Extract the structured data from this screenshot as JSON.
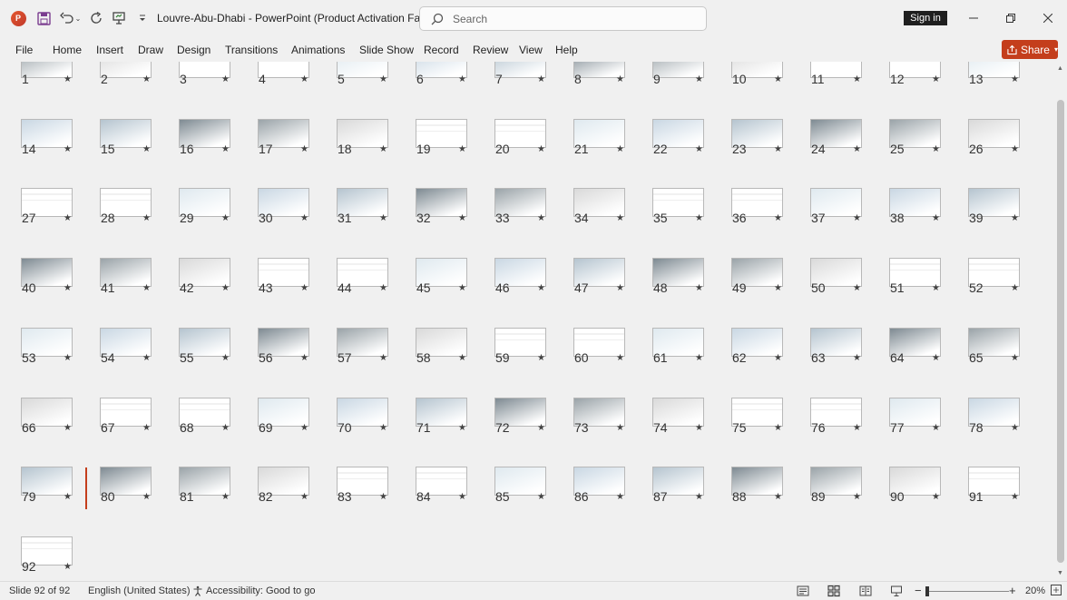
{
  "app": {
    "document_title": "Louvre-Abu-Dhabi  -  PowerPoint (Product Activation Fa...",
    "search_placeholder": "Search",
    "signin_label": "Sign in"
  },
  "menu": [
    "File",
    "Home",
    "Insert",
    "Draw",
    "Design",
    "Transitions",
    "Animations",
    "Slide Show",
    "Record",
    "Review",
    "View",
    "Help"
  ],
  "share_label": "Share",
  "slides": {
    "total": 92,
    "star": "★"
  },
  "status": {
    "slide_info": "Slide 92 of 92",
    "language": "English (United States)",
    "accessibility": "Accessibility: Good to go",
    "zoom": "20%",
    "zoom_minus": "−",
    "zoom_plus": "+"
  },
  "colors": {
    "accent": "#c43e1c",
    "background": "#f0f0f0"
  }
}
